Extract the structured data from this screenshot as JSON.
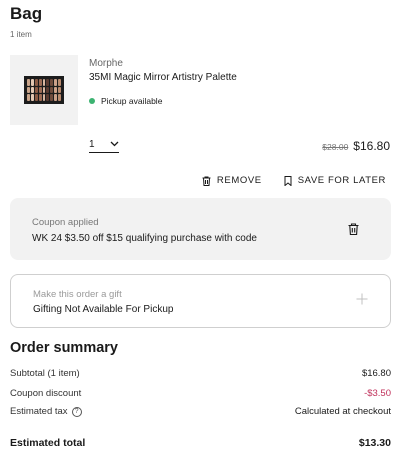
{
  "bag": {
    "title": "Bag",
    "count": "1 item"
  },
  "product": {
    "brand": "Morphe",
    "name": "35MI Magic Mirror Artistry Palette",
    "pickup": "Pickup available",
    "quantity": "1",
    "price_original": "$28.00",
    "price_current": "$16.80"
  },
  "actions": {
    "remove": "REMOVE",
    "save_for_later": "SAVE FOR LATER"
  },
  "coupon": {
    "label": "Coupon applied",
    "text": "WK 24 $3.50 off $15 qualifying purchase with code"
  },
  "gift": {
    "label": "Make this order a gift",
    "text": "Gifting Not Available For Pickup"
  },
  "summary": {
    "title": "Order summary",
    "subtotal_label": "Subtotal (1 item)",
    "subtotal_value": "$16.80",
    "coupon_label": "Coupon discount",
    "coupon_value": "-$3.50",
    "tax_label": "Estimated tax",
    "tax_value": "Calculated at checkout",
    "total_label": "Estimated total",
    "total_value": "$13.30"
  },
  "colors": {
    "pickup_dot": "#3cb371",
    "discount": "#c0305a"
  }
}
